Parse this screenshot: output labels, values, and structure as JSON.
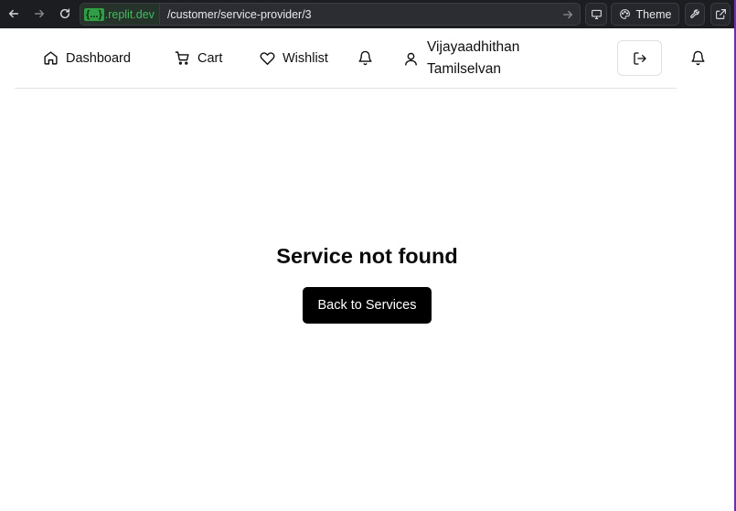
{
  "browser": {
    "url_domain_chip": "{...}",
    "url_domain": ".replit.dev",
    "url_path": "/customer/service-provider/3",
    "theme_label": "Theme"
  },
  "header": {
    "nav": [
      {
        "label": "Dashboard",
        "icon": "home-icon"
      },
      {
        "label": "Cart",
        "icon": "cart-icon"
      },
      {
        "label": "Wishlist",
        "icon": "heart-icon"
      }
    ],
    "user": {
      "first_name": "Vijayaadhithan",
      "last_name": "Tamilselvan"
    }
  },
  "main": {
    "title": "Service not found",
    "back_button": "Back to Services"
  },
  "colors": {
    "chrome_bg": "#1c1d21",
    "accent_green": "#3dbd5c",
    "button_bg": "#000000",
    "edge_purple": "#6b2fb3"
  }
}
